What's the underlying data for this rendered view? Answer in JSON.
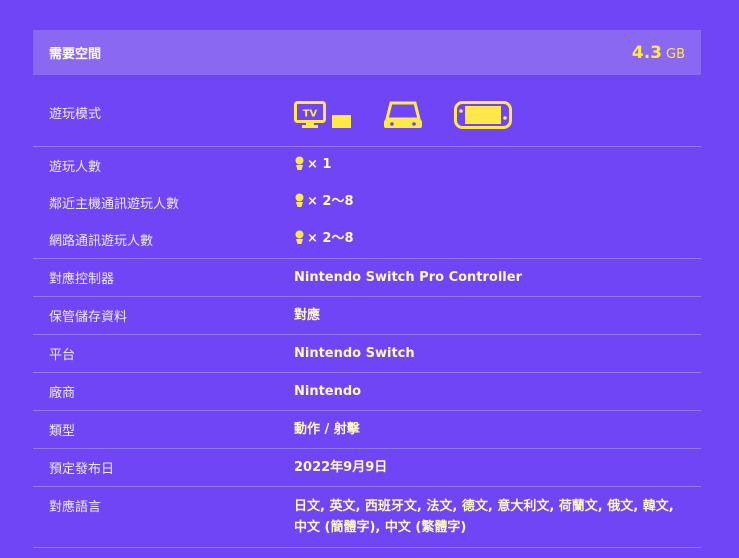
{
  "storage": {
    "label": "需要空間",
    "value": "4.3",
    "unit": "GB"
  },
  "play_modes": {
    "label": "遊玩模式",
    "icons": [
      "tv-mode-icon",
      "tabletop-mode-icon",
      "handheld-mode-icon"
    ],
    "tv_text": "TV"
  },
  "players": [
    {
      "label": "遊玩人數",
      "value": "× 1"
    },
    {
      "label": "鄰近主機通訊遊玩人數",
      "value": "× 2～8"
    },
    {
      "label": "網路通訊遊玩人數",
      "value": "× 2～8"
    }
  ],
  "details": [
    {
      "label": "對應控制器",
      "value": "Nintendo Switch Pro Controller"
    },
    {
      "label": "保管儲存資料",
      "value": "對應"
    },
    {
      "label": "平台",
      "value": "Nintendo Switch"
    },
    {
      "label": "廠商",
      "value": "Nintendo"
    },
    {
      "label": "類型",
      "value": "動作 / 射擊"
    },
    {
      "label": "預定發布日",
      "value": "2022年9月9日"
    },
    {
      "label": "對應語言",
      "value": "日文, 英文, 西班牙文, 法文, 德文, 意大利文, 荷蘭文, 俄文, 韓文, 中文 (簡體字), 中文 (繁體字)"
    }
  ],
  "colors": {
    "background": "#6f45f5",
    "accent": "#ffe94a",
    "bar": "#8a68f2"
  }
}
